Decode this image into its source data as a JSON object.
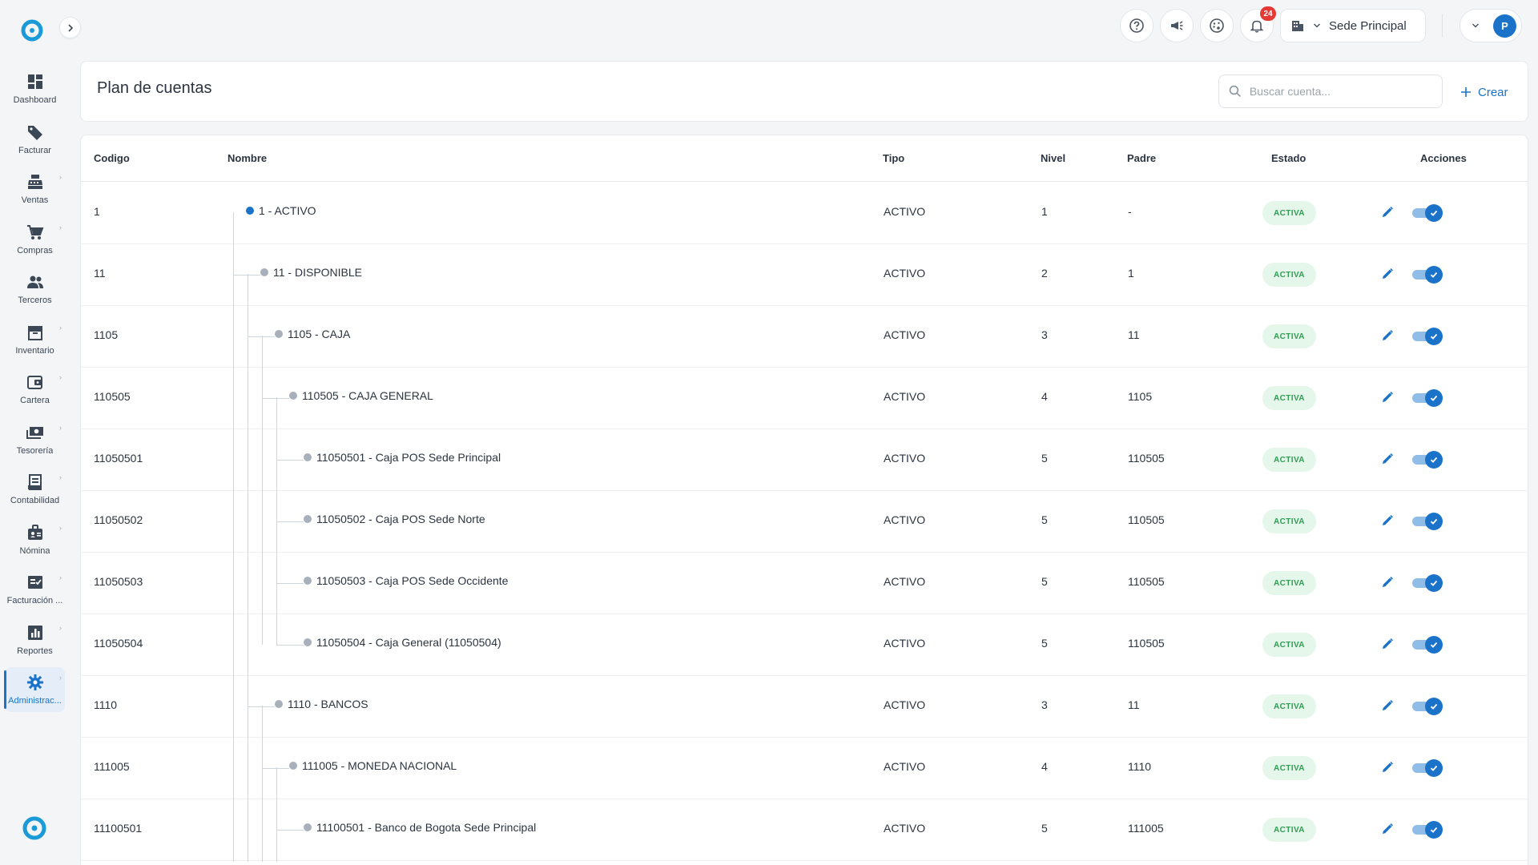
{
  "colors": {
    "accent": "#1a73c9",
    "status_green": "#2e9e52",
    "badge_red": "#e53935"
  },
  "sidebar": {
    "items": [
      {
        "label": "Dashboard",
        "icon": "dashboard-icon",
        "chevron": false,
        "active": false
      },
      {
        "label": "Facturar",
        "icon": "tag-icon",
        "chevron": false,
        "active": false
      },
      {
        "label": "Ventas",
        "icon": "cash-register-icon",
        "chevron": true,
        "active": false
      },
      {
        "label": "Compras",
        "icon": "cart-icon",
        "chevron": true,
        "active": false
      },
      {
        "label": "Terceros",
        "icon": "people-icon",
        "chevron": false,
        "active": false
      },
      {
        "label": "Inventario",
        "icon": "archive-icon",
        "chevron": true,
        "active": false
      },
      {
        "label": "Cartera",
        "icon": "wallet-icon",
        "chevron": true,
        "active": false
      },
      {
        "label": "Tesorería",
        "icon": "money-icon",
        "chevron": true,
        "active": false
      },
      {
        "label": "Contabilidad",
        "icon": "ledger-icon",
        "chevron": true,
        "active": false
      },
      {
        "label": "Nómina",
        "icon": "badge-icon",
        "chevron": true,
        "active": false
      },
      {
        "label": "Facturación ...",
        "icon": "invoice-check-icon",
        "chevron": true,
        "active": false
      },
      {
        "label": "Reportes",
        "icon": "report-icon",
        "chevron": true,
        "active": false
      },
      {
        "label": "Administrac...",
        "icon": "gear-icon",
        "chevron": true,
        "active": true
      }
    ]
  },
  "topbar": {
    "notification_count": "24",
    "sede_label": "Sede Principal",
    "avatar_initial": "P"
  },
  "page": {
    "title": "Plan de cuentas",
    "search_placeholder": "Buscar cuenta...",
    "create_label": "Crear"
  },
  "table": {
    "columns": {
      "codigo": "Codigo",
      "nombre": "Nombre",
      "tipo": "Tipo",
      "nivel": "Nivel",
      "padre": "Padre",
      "estado": "Estado",
      "acciones": "Acciones"
    },
    "rows": [
      {
        "codigo": "1",
        "nombre": "1 - ACTIVO",
        "tipo": "ACTIVO",
        "nivel": "1",
        "padre": "-",
        "estado": "ACTIVA",
        "active": true
      },
      {
        "codigo": "11",
        "nombre": "11 - DISPONIBLE",
        "tipo": "ACTIVO",
        "nivel": "2",
        "padre": "1",
        "estado": "ACTIVA",
        "active": true
      },
      {
        "codigo": "1105",
        "nombre": "1105 - CAJA",
        "tipo": "ACTIVO",
        "nivel": "3",
        "padre": "11",
        "estado": "ACTIVA",
        "active": true
      },
      {
        "codigo": "110505",
        "nombre": "110505 - CAJA GENERAL",
        "tipo": "ACTIVO",
        "nivel": "4",
        "padre": "1105",
        "estado": "ACTIVA",
        "active": true
      },
      {
        "codigo": "11050501",
        "nombre": "11050501 - Caja POS Sede Principal",
        "tipo": "ACTIVO",
        "nivel": "5",
        "padre": "110505",
        "estado": "ACTIVA",
        "active": true
      },
      {
        "codigo": "11050502",
        "nombre": "11050502 - Caja POS Sede Norte",
        "tipo": "ACTIVO",
        "nivel": "5",
        "padre": "110505",
        "estado": "ACTIVA",
        "active": true
      },
      {
        "codigo": "11050503",
        "nombre": "11050503 - Caja POS Sede Occidente",
        "tipo": "ACTIVO",
        "nivel": "5",
        "padre": "110505",
        "estado": "ACTIVA",
        "active": true
      },
      {
        "codigo": "11050504",
        "nombre": "11050504 - Caja General (11050504)",
        "tipo": "ACTIVO",
        "nivel": "5",
        "padre": "110505",
        "estado": "ACTIVA",
        "active": true
      },
      {
        "codigo": "1110",
        "nombre": "1110 - BANCOS",
        "tipo": "ACTIVO",
        "nivel": "3",
        "padre": "11",
        "estado": "ACTIVA",
        "active": true
      },
      {
        "codigo": "111005",
        "nombre": "111005 - MONEDA NACIONAL",
        "tipo": "ACTIVO",
        "nivel": "4",
        "padre": "1110",
        "estado": "ACTIVA",
        "active": true
      },
      {
        "codigo": "11100501",
        "nombre": "11100501 - Banco de Bogota Sede Principal",
        "tipo": "ACTIVO",
        "nivel": "5",
        "padre": "111005",
        "estado": "ACTIVA",
        "active": true
      }
    ]
  }
}
